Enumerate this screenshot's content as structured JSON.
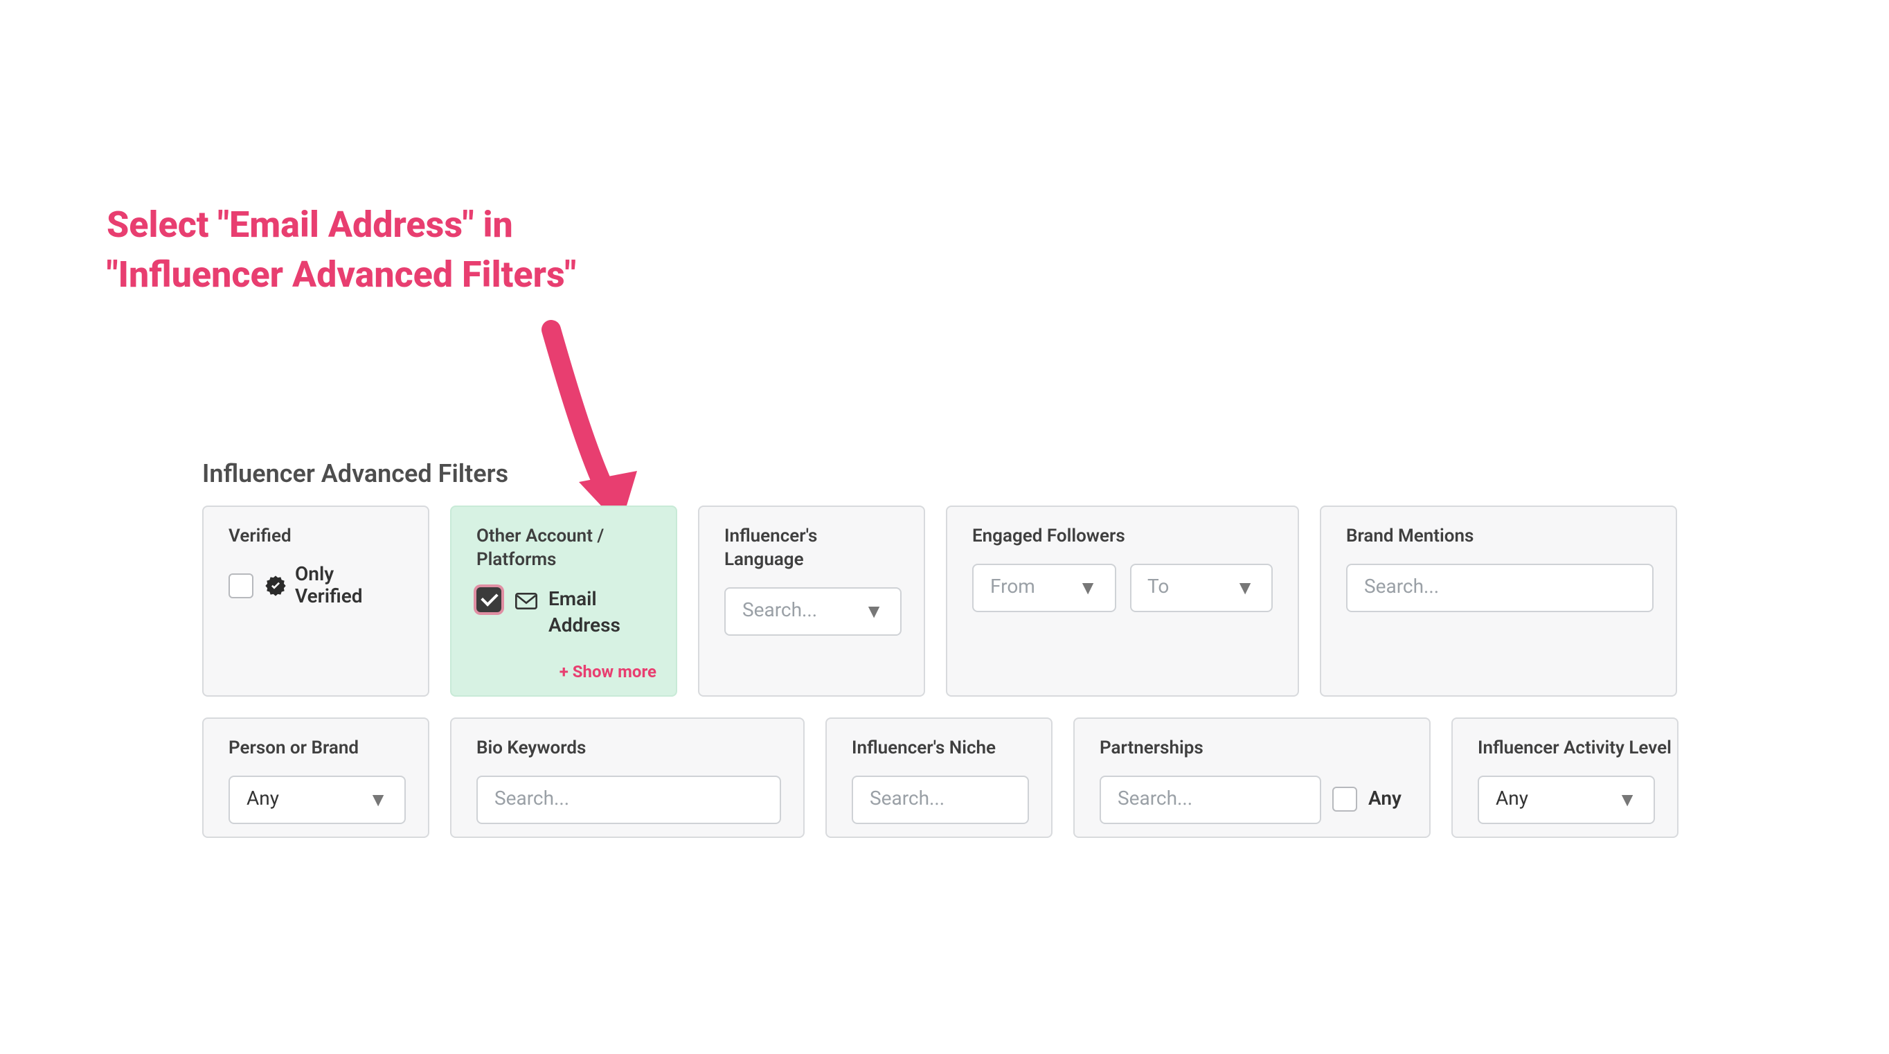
{
  "instruction": {
    "line1": "Select \"Email Address\" in",
    "line2": "\"Influencer Advanced Filters\""
  },
  "section_title": "Influencer Advanced Filters",
  "filters": {
    "verified": {
      "label": "Verified",
      "option_label": "Only Verified"
    },
    "other_platforms": {
      "label": "Other Account / Platforms",
      "email_label": "Email Address",
      "show_more": "+ Show more"
    },
    "language": {
      "label": "Influencer's Language",
      "placeholder": "Search..."
    },
    "engaged_followers": {
      "label": "Engaged Followers",
      "from_placeholder": "From",
      "to_placeholder": "To"
    },
    "brand_mentions": {
      "label": "Brand Mentions",
      "placeholder": "Search..."
    },
    "person_or_brand": {
      "label": "Person or Brand",
      "value": "Any"
    },
    "bio_keywords": {
      "label": "Bio Keywords",
      "placeholder": "Search..."
    },
    "niche": {
      "label": "Influencer's Niche",
      "placeholder": "Search..."
    },
    "partnerships": {
      "label": "Partnerships",
      "placeholder": "Search...",
      "any_label": "Any"
    },
    "activity": {
      "label": "Influencer Activity Level",
      "value": "Any"
    }
  }
}
